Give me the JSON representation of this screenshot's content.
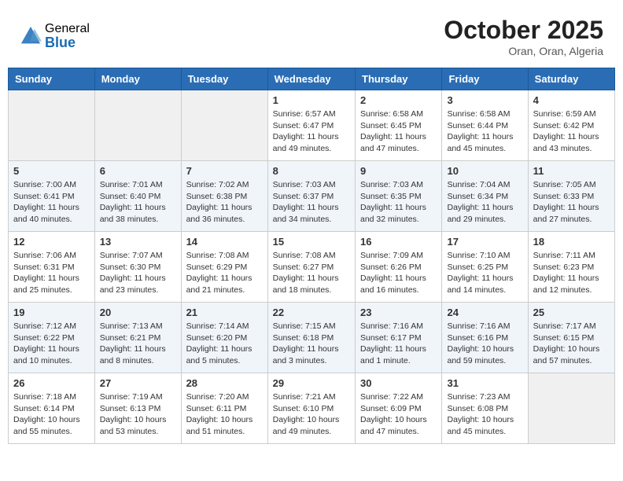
{
  "header": {
    "logo_general": "General",
    "logo_blue": "Blue",
    "month_year": "October 2025",
    "location": "Oran, Oran, Algeria"
  },
  "calendar": {
    "days_of_week": [
      "Sunday",
      "Monday",
      "Tuesday",
      "Wednesday",
      "Thursday",
      "Friday",
      "Saturday"
    ],
    "rows": [
      [
        {
          "day": "",
          "empty": true
        },
        {
          "day": "",
          "empty": true
        },
        {
          "day": "",
          "empty": true
        },
        {
          "day": "1",
          "sunrise": "Sunrise: 6:57 AM",
          "sunset": "Sunset: 6:47 PM",
          "daylight": "Daylight: 11 hours and 49 minutes."
        },
        {
          "day": "2",
          "sunrise": "Sunrise: 6:58 AM",
          "sunset": "Sunset: 6:45 PM",
          "daylight": "Daylight: 11 hours and 47 minutes."
        },
        {
          "day": "3",
          "sunrise": "Sunrise: 6:58 AM",
          "sunset": "Sunset: 6:44 PM",
          "daylight": "Daylight: 11 hours and 45 minutes."
        },
        {
          "day": "4",
          "sunrise": "Sunrise: 6:59 AM",
          "sunset": "Sunset: 6:42 PM",
          "daylight": "Daylight: 11 hours and 43 minutes."
        }
      ],
      [
        {
          "day": "5",
          "sunrise": "Sunrise: 7:00 AM",
          "sunset": "Sunset: 6:41 PM",
          "daylight": "Daylight: 11 hours and 40 minutes."
        },
        {
          "day": "6",
          "sunrise": "Sunrise: 7:01 AM",
          "sunset": "Sunset: 6:40 PM",
          "daylight": "Daylight: 11 hours and 38 minutes."
        },
        {
          "day": "7",
          "sunrise": "Sunrise: 7:02 AM",
          "sunset": "Sunset: 6:38 PM",
          "daylight": "Daylight: 11 hours and 36 minutes."
        },
        {
          "day": "8",
          "sunrise": "Sunrise: 7:03 AM",
          "sunset": "Sunset: 6:37 PM",
          "daylight": "Daylight: 11 hours and 34 minutes."
        },
        {
          "day": "9",
          "sunrise": "Sunrise: 7:03 AM",
          "sunset": "Sunset: 6:35 PM",
          "daylight": "Daylight: 11 hours and 32 minutes."
        },
        {
          "day": "10",
          "sunrise": "Sunrise: 7:04 AM",
          "sunset": "Sunset: 6:34 PM",
          "daylight": "Daylight: 11 hours and 29 minutes."
        },
        {
          "day": "11",
          "sunrise": "Sunrise: 7:05 AM",
          "sunset": "Sunset: 6:33 PM",
          "daylight": "Daylight: 11 hours and 27 minutes."
        }
      ],
      [
        {
          "day": "12",
          "sunrise": "Sunrise: 7:06 AM",
          "sunset": "Sunset: 6:31 PM",
          "daylight": "Daylight: 11 hours and 25 minutes."
        },
        {
          "day": "13",
          "sunrise": "Sunrise: 7:07 AM",
          "sunset": "Sunset: 6:30 PM",
          "daylight": "Daylight: 11 hours and 23 minutes."
        },
        {
          "day": "14",
          "sunrise": "Sunrise: 7:08 AM",
          "sunset": "Sunset: 6:29 PM",
          "daylight": "Daylight: 11 hours and 21 minutes."
        },
        {
          "day": "15",
          "sunrise": "Sunrise: 7:08 AM",
          "sunset": "Sunset: 6:27 PM",
          "daylight": "Daylight: 11 hours and 18 minutes."
        },
        {
          "day": "16",
          "sunrise": "Sunrise: 7:09 AM",
          "sunset": "Sunset: 6:26 PM",
          "daylight": "Daylight: 11 hours and 16 minutes."
        },
        {
          "day": "17",
          "sunrise": "Sunrise: 7:10 AM",
          "sunset": "Sunset: 6:25 PM",
          "daylight": "Daylight: 11 hours and 14 minutes."
        },
        {
          "day": "18",
          "sunrise": "Sunrise: 7:11 AM",
          "sunset": "Sunset: 6:23 PM",
          "daylight": "Daylight: 11 hours and 12 minutes."
        }
      ],
      [
        {
          "day": "19",
          "sunrise": "Sunrise: 7:12 AM",
          "sunset": "Sunset: 6:22 PM",
          "daylight": "Daylight: 11 hours and 10 minutes."
        },
        {
          "day": "20",
          "sunrise": "Sunrise: 7:13 AM",
          "sunset": "Sunset: 6:21 PM",
          "daylight": "Daylight: 11 hours and 8 minutes."
        },
        {
          "day": "21",
          "sunrise": "Sunrise: 7:14 AM",
          "sunset": "Sunset: 6:20 PM",
          "daylight": "Daylight: 11 hours and 5 minutes."
        },
        {
          "day": "22",
          "sunrise": "Sunrise: 7:15 AM",
          "sunset": "Sunset: 6:18 PM",
          "daylight": "Daylight: 11 hours and 3 minutes."
        },
        {
          "day": "23",
          "sunrise": "Sunrise: 7:16 AM",
          "sunset": "Sunset: 6:17 PM",
          "daylight": "Daylight: 11 hours and 1 minute."
        },
        {
          "day": "24",
          "sunrise": "Sunrise: 7:16 AM",
          "sunset": "Sunset: 6:16 PM",
          "daylight": "Daylight: 10 hours and 59 minutes."
        },
        {
          "day": "25",
          "sunrise": "Sunrise: 7:17 AM",
          "sunset": "Sunset: 6:15 PM",
          "daylight": "Daylight: 10 hours and 57 minutes."
        }
      ],
      [
        {
          "day": "26",
          "sunrise": "Sunrise: 7:18 AM",
          "sunset": "Sunset: 6:14 PM",
          "daylight": "Daylight: 10 hours and 55 minutes."
        },
        {
          "day": "27",
          "sunrise": "Sunrise: 7:19 AM",
          "sunset": "Sunset: 6:13 PM",
          "daylight": "Daylight: 10 hours and 53 minutes."
        },
        {
          "day": "28",
          "sunrise": "Sunrise: 7:20 AM",
          "sunset": "Sunset: 6:11 PM",
          "daylight": "Daylight: 10 hours and 51 minutes."
        },
        {
          "day": "29",
          "sunrise": "Sunrise: 7:21 AM",
          "sunset": "Sunset: 6:10 PM",
          "daylight": "Daylight: 10 hours and 49 minutes."
        },
        {
          "day": "30",
          "sunrise": "Sunrise: 7:22 AM",
          "sunset": "Sunset: 6:09 PM",
          "daylight": "Daylight: 10 hours and 47 minutes."
        },
        {
          "day": "31",
          "sunrise": "Sunrise: 7:23 AM",
          "sunset": "Sunset: 6:08 PM",
          "daylight": "Daylight: 10 hours and 45 minutes."
        },
        {
          "day": "",
          "empty": true
        }
      ]
    ]
  }
}
